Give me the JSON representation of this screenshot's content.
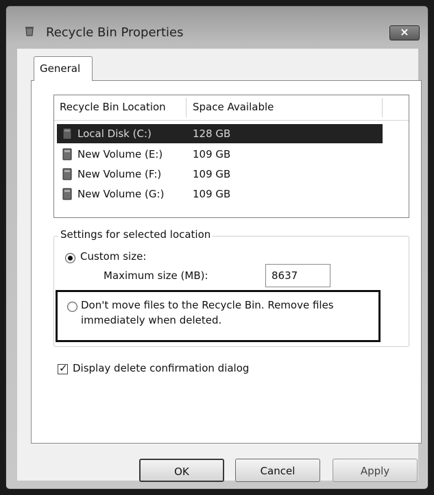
{
  "window": {
    "title": "Recycle Bin Properties",
    "close_symbol": "×"
  },
  "tabs": [
    {
      "label": "General",
      "selected": true
    }
  ],
  "list": {
    "columns": [
      "Recycle Bin Location",
      "Space Available"
    ],
    "rows": [
      {
        "name": "Local Disk (C:)",
        "space": "128 GB",
        "selected": true
      },
      {
        "name": "New Volume (E:)",
        "space": "109 GB",
        "selected": false
      },
      {
        "name": "New Volume (F:)",
        "space": "109 GB",
        "selected": false
      },
      {
        "name": "New Volume (G:)",
        "space": "109 GB",
        "selected": false
      }
    ]
  },
  "settings": {
    "legend": "Settings for selected location",
    "custom_size_label": "Custom size:",
    "custom_size_checked": true,
    "max_size_label": "Maximum size (MB):",
    "max_size_value": "8637",
    "dont_move_label": "Don't move files to the Recycle Bin. Remove files immediately when deleted.",
    "dont_move_checked": false
  },
  "confirm": {
    "label": "Display delete confirmation dialog",
    "checked": true
  },
  "buttons": {
    "ok": "OK",
    "cancel": "Cancel",
    "apply": "Apply"
  },
  "icons": {
    "title": "recycle-bin-icon",
    "disk": "disk-drive-icon"
  }
}
